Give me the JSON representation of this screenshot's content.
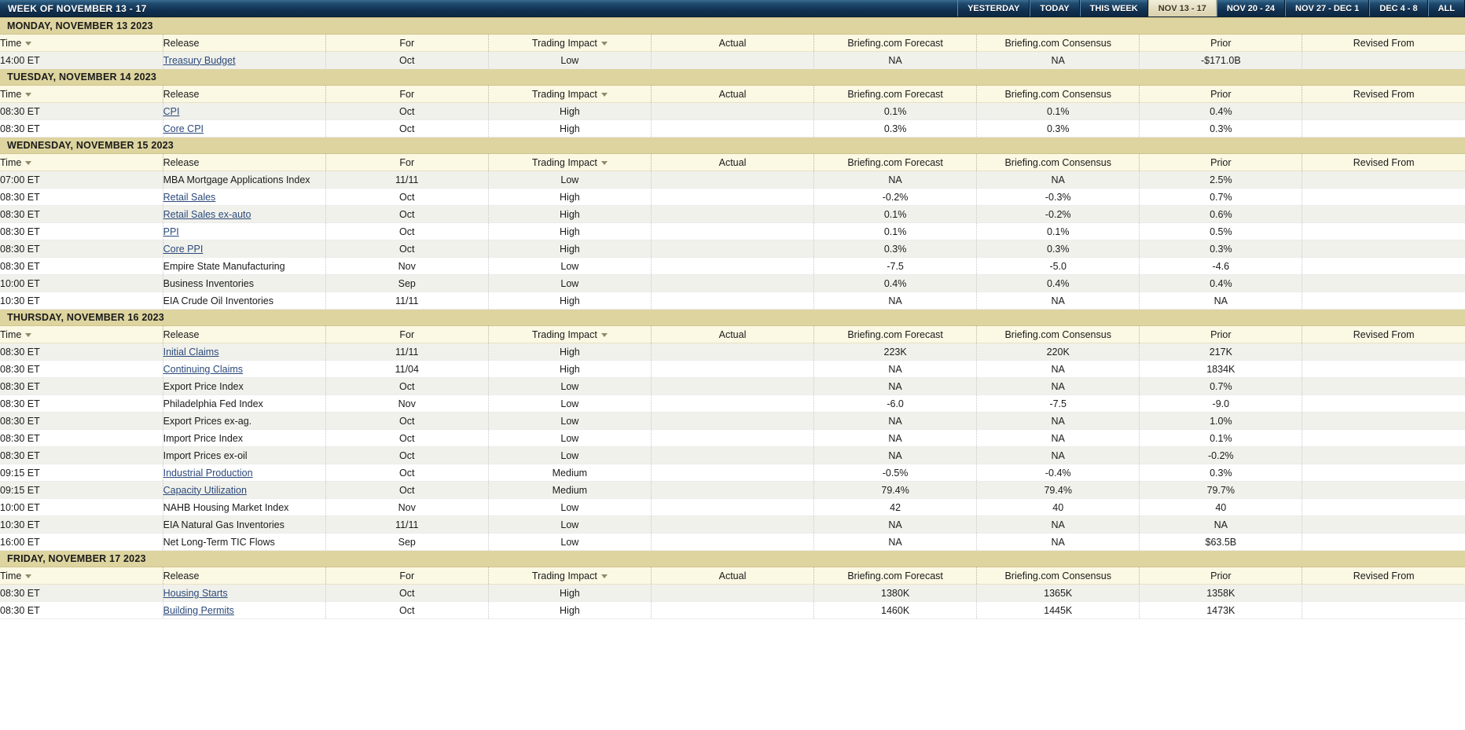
{
  "header": {
    "title": "WEEK OF NOVEMBER 13 - 17",
    "nav": [
      {
        "label": "YESTERDAY",
        "active": false
      },
      {
        "label": "TODAY",
        "active": false
      },
      {
        "label": "THIS WEEK",
        "active": false
      },
      {
        "label": "NOV 13 - 17",
        "active": true
      },
      {
        "label": "NOV 20 - 24",
        "active": false
      },
      {
        "label": "NOV 27 - DEC 1",
        "active": false
      },
      {
        "label": "DEC 4 - 8",
        "active": false
      },
      {
        "label": "ALL",
        "active": false
      }
    ]
  },
  "columns": {
    "time": "Time",
    "release": "Release",
    "for": "For",
    "impact": "Trading Impact",
    "actual": "Actual",
    "forecast": "Briefing.com Forecast",
    "consensus": "Briefing.com Consensus",
    "prior": "Prior",
    "revised": "Revised From"
  },
  "colors": {
    "header_bar": "#123052",
    "day_header": "#ddd49f",
    "column_header": "#fbf8e3",
    "alt_row": "#f1f1ec",
    "link": "#2b4a7a",
    "active_tab": "#e4ddc0"
  },
  "days": [
    {
      "label": "MONDAY, NOVEMBER 13 2023",
      "rows": [
        {
          "time": "14:00 ET",
          "release": "Treasury Budget",
          "link": true,
          "for": "Oct",
          "impact": "Low",
          "actual": "",
          "forecast": "NA",
          "consensus": "NA",
          "prior": "-$171.0B",
          "revised": ""
        }
      ]
    },
    {
      "label": "TUESDAY, NOVEMBER 14 2023",
      "rows": [
        {
          "time": "08:30 ET",
          "release": "CPI",
          "link": true,
          "for": "Oct",
          "impact": "High",
          "actual": "",
          "forecast": "0.1%",
          "consensus": "0.1%",
          "prior": "0.4%",
          "revised": ""
        },
        {
          "time": "08:30 ET",
          "release": "Core CPI",
          "link": true,
          "for": "Oct",
          "impact": "High",
          "actual": "",
          "forecast": "0.3%",
          "consensus": "0.3%",
          "prior": "0.3%",
          "revised": ""
        }
      ]
    },
    {
      "label": "WEDNESDAY, NOVEMBER 15 2023",
      "rows": [
        {
          "time": "07:00 ET",
          "release": "MBA Mortgage Applications Index",
          "link": false,
          "for": "11/11",
          "impact": "Low",
          "actual": "",
          "forecast": "NA",
          "consensus": "NA",
          "prior": "2.5%",
          "revised": ""
        },
        {
          "time": "08:30 ET",
          "release": "Retail Sales",
          "link": true,
          "for": "Oct",
          "impact": "High",
          "actual": "",
          "forecast": "-0.2%",
          "consensus": "-0.3%",
          "prior": "0.7%",
          "revised": ""
        },
        {
          "time": "08:30 ET",
          "release": "Retail Sales ex-auto",
          "link": true,
          "for": "Oct",
          "impact": "High",
          "actual": "",
          "forecast": "0.1%",
          "consensus": "-0.2%",
          "prior": "0.6%",
          "revised": ""
        },
        {
          "time": "08:30 ET",
          "release": "PPI",
          "link": true,
          "for": "Oct",
          "impact": "High",
          "actual": "",
          "forecast": "0.1%",
          "consensus": "0.1%",
          "prior": "0.5%",
          "revised": ""
        },
        {
          "time": "08:30 ET",
          "release": "Core PPI",
          "link": true,
          "for": "Oct",
          "impact": "High",
          "actual": "",
          "forecast": "0.3%",
          "consensus": "0.3%",
          "prior": "0.3%",
          "revised": ""
        },
        {
          "time": "08:30 ET",
          "release": "Empire State Manufacturing",
          "link": false,
          "for": "Nov",
          "impact": "Low",
          "actual": "",
          "forecast": "-7.5",
          "consensus": "-5.0",
          "prior": "-4.6",
          "revised": ""
        },
        {
          "time": "10:00 ET",
          "release": "Business Inventories",
          "link": false,
          "for": "Sep",
          "impact": "Low",
          "actual": "",
          "forecast": "0.4%",
          "consensus": "0.4%",
          "prior": "0.4%",
          "revised": ""
        },
        {
          "time": "10:30 ET",
          "release": "EIA Crude Oil Inventories",
          "link": false,
          "for": "11/11",
          "impact": "High",
          "actual": "",
          "forecast": "NA",
          "consensus": "NA",
          "prior": "NA",
          "revised": ""
        }
      ]
    },
    {
      "label": "THURSDAY, NOVEMBER 16 2023",
      "rows": [
        {
          "time": "08:30 ET",
          "release": "Initial Claims",
          "link": true,
          "for": "11/11",
          "impact": "High",
          "actual": "",
          "forecast": "223K",
          "consensus": "220K",
          "prior": "217K",
          "revised": ""
        },
        {
          "time": "08:30 ET",
          "release": "Continuing Claims",
          "link": true,
          "for": "11/04",
          "impact": "High",
          "actual": "",
          "forecast": "NA",
          "consensus": "NA",
          "prior": "1834K",
          "revised": ""
        },
        {
          "time": "08:30 ET",
          "release": "Export Price Index",
          "link": false,
          "for": "Oct",
          "impact": "Low",
          "actual": "",
          "forecast": "NA",
          "consensus": "NA",
          "prior": "0.7%",
          "revised": ""
        },
        {
          "time": "08:30 ET",
          "release": "Philadelphia Fed Index",
          "link": false,
          "for": "Nov",
          "impact": "Low",
          "actual": "",
          "forecast": "-6.0",
          "consensus": "-7.5",
          "prior": "-9.0",
          "revised": ""
        },
        {
          "time": "08:30 ET",
          "release": "Export Prices ex-ag.",
          "link": false,
          "for": "Oct",
          "impact": "Low",
          "actual": "",
          "forecast": "NA",
          "consensus": "NA",
          "prior": "1.0%",
          "revised": ""
        },
        {
          "time": "08:30 ET",
          "release": "Import Price Index",
          "link": false,
          "for": "Oct",
          "impact": "Low",
          "actual": "",
          "forecast": "NA",
          "consensus": "NA",
          "prior": "0.1%",
          "revised": ""
        },
        {
          "time": "08:30 ET",
          "release": "Import Prices ex-oil",
          "link": false,
          "for": "Oct",
          "impact": "Low",
          "actual": "",
          "forecast": "NA",
          "consensus": "NA",
          "prior": "-0.2%",
          "revised": ""
        },
        {
          "time": "09:15 ET",
          "release": "Industrial Production",
          "link": true,
          "for": "Oct",
          "impact": "Medium",
          "actual": "",
          "forecast": "-0.5%",
          "consensus": "-0.4%",
          "prior": "0.3%",
          "revised": ""
        },
        {
          "time": "09:15 ET",
          "release": "Capacity Utilization",
          "link": true,
          "for": "Oct",
          "impact": "Medium",
          "actual": "",
          "forecast": "79.4%",
          "consensus": "79.4%",
          "prior": "79.7%",
          "revised": ""
        },
        {
          "time": "10:00 ET",
          "release": "NAHB Housing Market Index",
          "link": false,
          "for": "Nov",
          "impact": "Low",
          "actual": "",
          "forecast": "42",
          "consensus": "40",
          "prior": "40",
          "revised": ""
        },
        {
          "time": "10:30 ET",
          "release": "EIA Natural Gas Inventories",
          "link": false,
          "for": "11/11",
          "impact": "Low",
          "actual": "",
          "forecast": "NA",
          "consensus": "NA",
          "prior": "NA",
          "revised": ""
        },
        {
          "time": "16:00 ET",
          "release": "Net Long-Term TIC Flows",
          "link": false,
          "for": "Sep",
          "impact": "Low",
          "actual": "",
          "forecast": "NA",
          "consensus": "NA",
          "prior": "$63.5B",
          "revised": ""
        }
      ]
    },
    {
      "label": "FRIDAY, NOVEMBER 17 2023",
      "rows": [
        {
          "time": "08:30 ET",
          "release": "Housing Starts",
          "link": true,
          "for": "Oct",
          "impact": "High",
          "actual": "",
          "forecast": "1380K",
          "consensus": "1365K",
          "prior": "1358K",
          "revised": ""
        },
        {
          "time": "08:30 ET",
          "release": "Building Permits",
          "link": true,
          "for": "Oct",
          "impact": "High",
          "actual": "",
          "forecast": "1460K",
          "consensus": "1445K",
          "prior": "1473K",
          "revised": ""
        }
      ]
    }
  ]
}
